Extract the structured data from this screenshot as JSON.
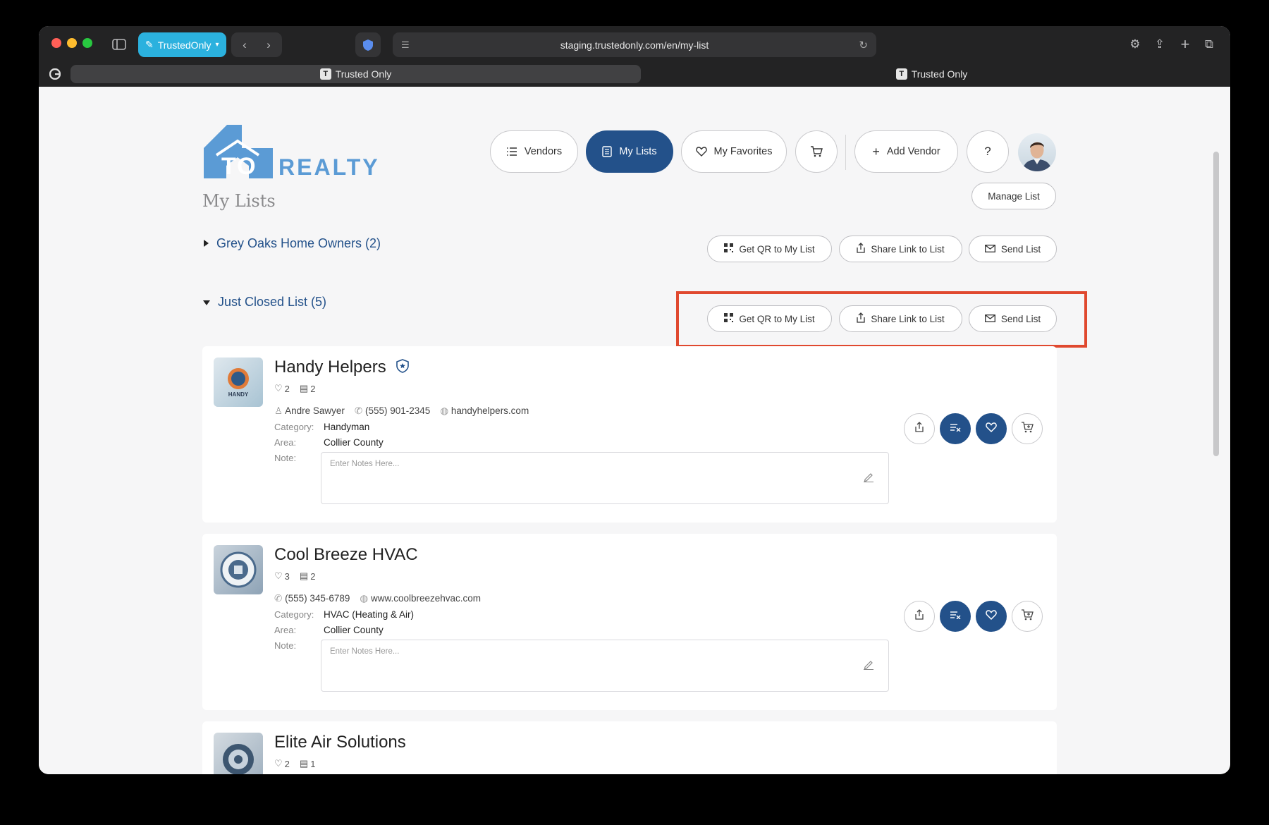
{
  "browser": {
    "profile": "TrustedOnly",
    "url": "staging.trustedonly.com/en/my-list",
    "tabs": [
      {
        "title": "Trusted Only",
        "logo": "T"
      },
      {
        "title": "Trusted Only",
        "logo": "T"
      }
    ]
  },
  "brand": {
    "logo_text_1": "TO",
    "logo_text_2": "REALTY",
    "accent": "#23518a",
    "logo_color": "#5b9bd5"
  },
  "nav": {
    "vendors": "Vendors",
    "my_lists": "My Lists",
    "my_favorites": "My Favorites",
    "add_vendor": "Add Vendor",
    "help": "?"
  },
  "page": {
    "title": "My Lists",
    "manage_list": "Manage List"
  },
  "list_actions": {
    "qr": "Get QR to My List",
    "share": "Share Link to List",
    "send": "Send List"
  },
  "lists": [
    {
      "name": "Grey Oaks Home Owners (2)",
      "expanded": false
    },
    {
      "name": "Just Closed List (5)",
      "expanded": true
    }
  ],
  "labels": {
    "category": "Category:",
    "area": "Area:",
    "note": "Note:",
    "note_placeholder": "Enter Notes Here..."
  },
  "vendors": [
    {
      "name": "Handy Helpers",
      "likes": "2",
      "lists": "2",
      "contact": "Andre Sawyer",
      "phone": "(555) 901-2345",
      "website": "handyhelpers.com",
      "category": "Handyman",
      "area": "Collier County",
      "logo_text": "HANDY"
    },
    {
      "name": "Cool Breeze HVAC",
      "likes": "3",
      "lists": "2",
      "phone": "(555) 345-6789",
      "website": "www.coolbreezehvac.com",
      "category": "HVAC (Heating & Air)",
      "area": "Collier County"
    },
    {
      "name": "Elite Air Solutions",
      "likes": "2",
      "lists": "1"
    }
  ]
}
